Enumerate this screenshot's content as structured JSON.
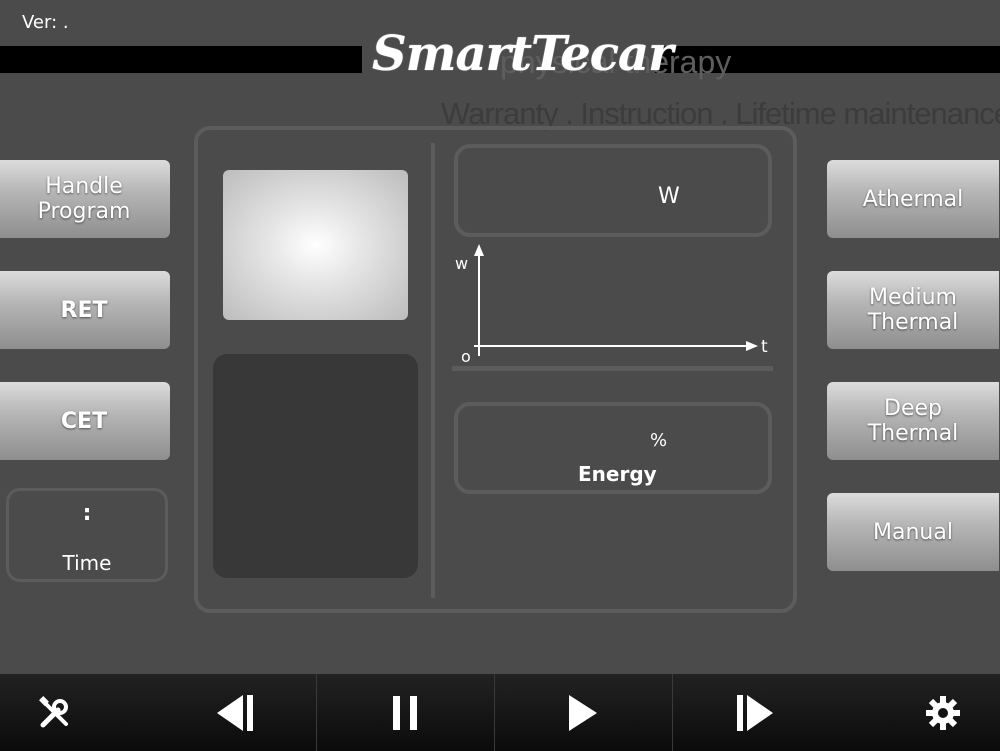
{
  "header": {
    "version_label": "Ver:  .",
    "logo_text": "SmartTecar",
    "watermark_line1": "physical therapy",
    "watermark_line2": "Warranty . Instruction . Lifetime maintenance"
  },
  "left_buttons": [
    {
      "label_line1": "Handle",
      "label_line2": "Program"
    },
    {
      "label": "RET"
    },
    {
      "label": "CET"
    }
  ],
  "time": {
    "value": ":",
    "label": "Time"
  },
  "power": {
    "unit": "W"
  },
  "graph": {
    "y_axis": "w",
    "x_axis": "t",
    "origin": "o"
  },
  "energy": {
    "unit": "%",
    "label": "Energy"
  },
  "right_buttons": [
    {
      "label_line1": "Athermal",
      "label_line2": ""
    },
    {
      "label_line1": "Medium",
      "label_line2": "Thermal"
    },
    {
      "label_line1": "Deep",
      "label_line2": "Thermal"
    },
    {
      "label_line1": "Manual",
      "label_line2": ""
    }
  ],
  "bottom_bar": {
    "icons": [
      "tools-icon",
      "previous-icon",
      "pause-icon",
      "play-icon",
      "next-icon",
      "settings-gear-icon"
    ]
  },
  "colors": {
    "background": "#4b4b4b",
    "border": "#5c5c5c",
    "bar": "#000000"
  }
}
